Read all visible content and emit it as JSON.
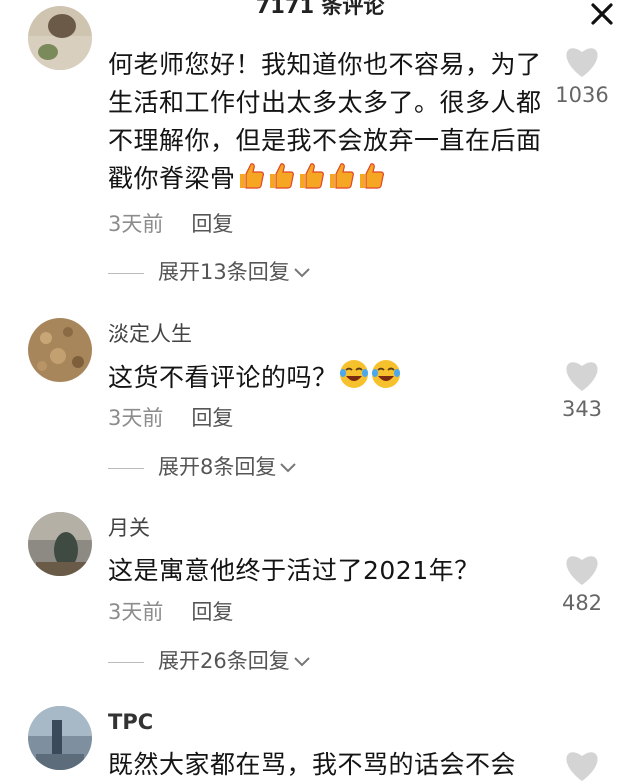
{
  "header": {
    "title": "7171 条评论"
  },
  "comments": [
    {
      "username": "",
      "text": "何老师您好！我知道你也不容易，为了生活和工作付出太多太多了。很多人都不理解你，但是我不会放弃一直在后面戳你脊梁骨",
      "emoji_count": 5,
      "time": "3天前",
      "reply_label": "回复",
      "expand_label": "展开13条回复",
      "likes": "1036"
    },
    {
      "username": "淡定人生",
      "text": "这货不看评论的吗？",
      "emoji_count": 2,
      "time": "3天前",
      "reply_label": "回复",
      "expand_label": "展开8条回复",
      "likes": "343"
    },
    {
      "username": "月关",
      "text": "这是寓意他终于活过了2021年？",
      "time": "3天前",
      "reply_label": "回复",
      "expand_label": "展开26条回复",
      "likes": "482"
    },
    {
      "username": "TPC",
      "text": "既然大家都在骂，我不骂的话会不会"
    }
  ],
  "icons": {
    "like": "heart-icon",
    "close": "close-icon",
    "thumbs_up": "thumbs-up-emoji",
    "laughing": "tears-of-joy-emoji"
  },
  "colors": {
    "heart": "#d4d4d4",
    "thumb": "#f5a623",
    "laugh": "#f7c12e"
  }
}
